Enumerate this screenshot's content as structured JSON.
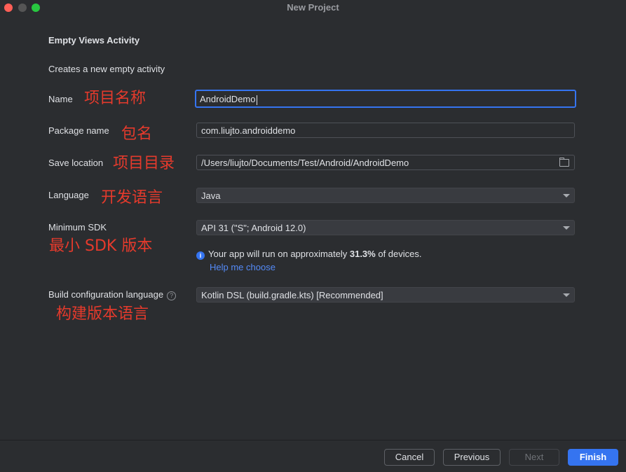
{
  "window": {
    "title": "New Project"
  },
  "header": {
    "heading": "Empty Views Activity",
    "description": "Creates a new empty activity"
  },
  "form": {
    "name": {
      "label": "Name",
      "annotation": "项目名称",
      "value": "AndroidDemo"
    },
    "package_name": {
      "label": "Package name",
      "annotation": "包名",
      "value": "com.liujto.androiddemo"
    },
    "save_location": {
      "label": "Save location",
      "annotation": "项目目录",
      "value": "/Users/liujto/Documents/Test/Android/AndroidDemo"
    },
    "language": {
      "label": "Language",
      "annotation": "开发语言",
      "value": "Java"
    },
    "minimum_sdk": {
      "label": "Minimum SDK",
      "annotation": "最小 SDK 版本",
      "value": "API 31 (\"S\"; Android 12.0)"
    },
    "sdk_info": {
      "prefix": "Your app will run on approximately ",
      "percent": "31.3%",
      "suffix": " of devices.",
      "help_link": "Help me choose"
    },
    "build_config": {
      "label": "Build configuration language",
      "annotation": "构建版本语言",
      "value": "Kotlin DSL (build.gradle.kts) [Recommended]"
    }
  },
  "footer": {
    "cancel": "Cancel",
    "previous": "Previous",
    "next": "Next",
    "finish": "Finish"
  },
  "colors": {
    "background": "#2b2d30",
    "accent": "#3574f0",
    "annotation": "#e53a2c",
    "link": "#548af7"
  }
}
